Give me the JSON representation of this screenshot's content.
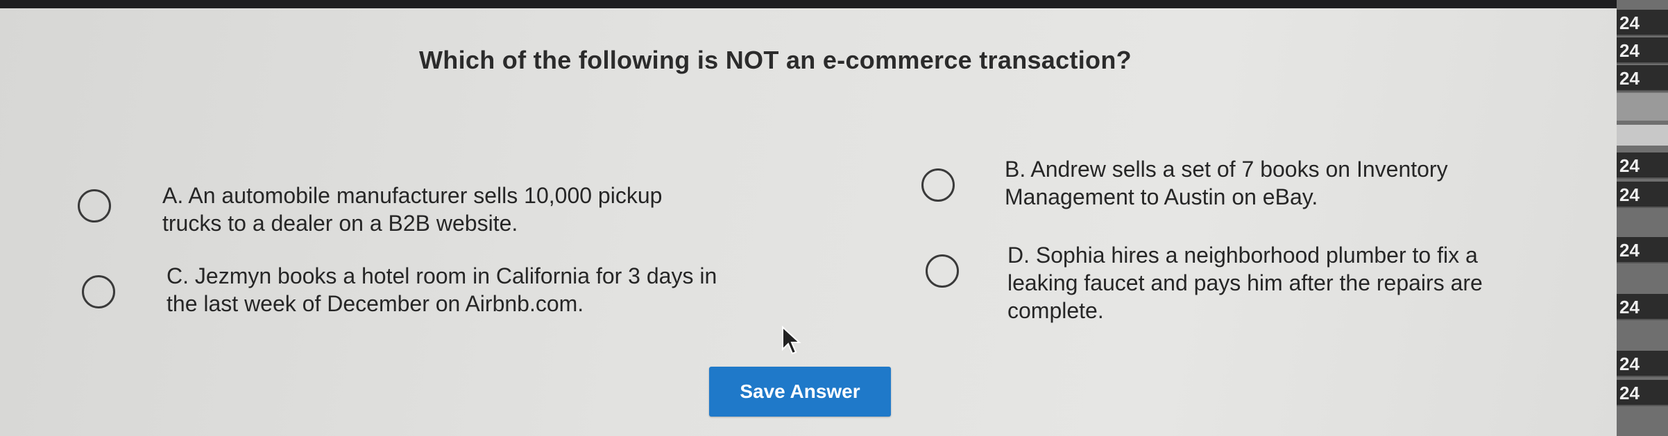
{
  "question": "Which of the following is NOT an e-commerce transaction?",
  "options": [
    {
      "letter": "A",
      "text": "A. An automobile manufacturer sells 10,000 pickup trucks to a dealer on a B2B website."
    },
    {
      "letter": "B",
      "text": "B. Andrew sells a set of 7 books on Inventory Management to Austin on eBay."
    },
    {
      "letter": "C",
      "text": "C. Jezmyn books a hotel room in California for 3 days in the last week of December on Airbnb.com."
    },
    {
      "letter": "D",
      "text": "D. Sophia hires a neighborhood plumber to fix a leaking faucet and pays him after the repairs are complete."
    }
  ],
  "save_button": "Save Answer",
  "side_panel": {
    "numbers": [
      "24",
      "24",
      "24",
      "24",
      "24",
      "24",
      "24",
      "24",
      "24"
    ]
  },
  "colors": {
    "button": "#1f79c9",
    "background": "#e2e2e0",
    "side_panel": "#2c2c2c"
  }
}
